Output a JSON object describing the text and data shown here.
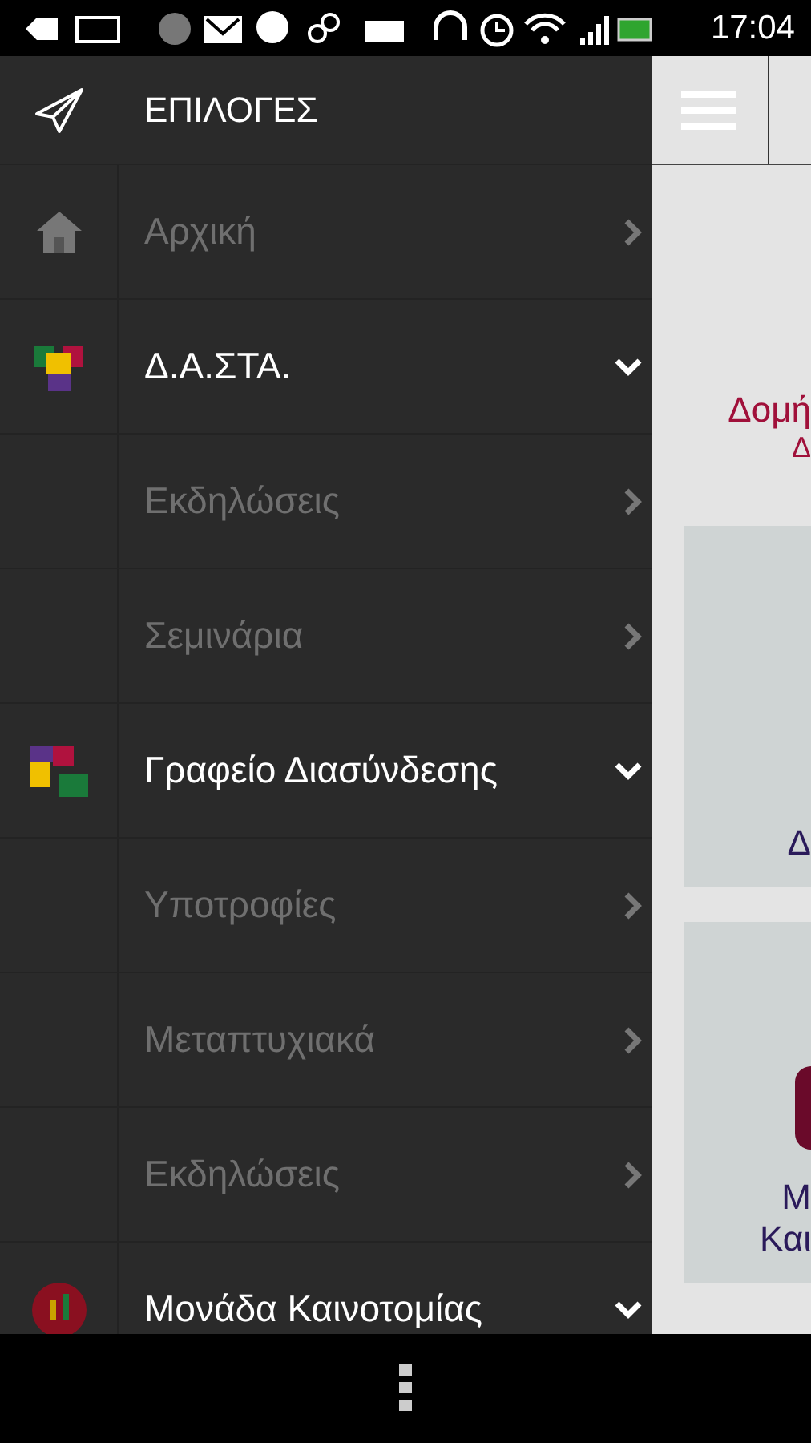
{
  "status_bar": {
    "time": "17:04"
  },
  "drawer": {
    "title": "ΕΠΙΛΟΓΕΣ",
    "items": [
      {
        "kind": "link",
        "label": "Αρχική",
        "expanded": false
      },
      {
        "kind": "group",
        "label": "Δ.Α.ΣΤΑ.",
        "expanded": true
      },
      {
        "kind": "sub",
        "label": "Εκδηλώσεις",
        "expanded": false
      },
      {
        "kind": "sub",
        "label": "Σεμινάρια",
        "expanded": false
      },
      {
        "kind": "group",
        "label": "Γραφείο Διασύνδεσης",
        "expanded": true
      },
      {
        "kind": "sub",
        "label": "Υποτροφίες",
        "expanded": false
      },
      {
        "kind": "sub",
        "label": "Μεταπτυχιακά",
        "expanded": false
      },
      {
        "kind": "sub",
        "label": "Εκδηλώσεις",
        "expanded": false
      },
      {
        "kind": "group",
        "label": "Μονάδα Καινοτομίας",
        "expanded": true
      }
    ]
  },
  "content": {
    "heading": [
      "Δομή",
      "Δ"
    ],
    "cards": [
      {
        "lines": [
          "Δ"
        ],
        "logo": false
      },
      {
        "lines": [
          "Μ",
          "Και"
        ],
        "logo": true
      }
    ]
  }
}
